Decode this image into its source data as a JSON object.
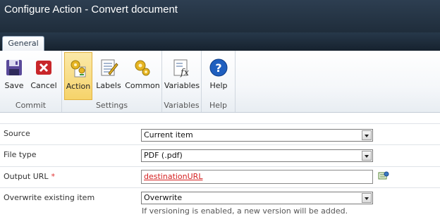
{
  "window": {
    "title": "Configure Action - Convert document"
  },
  "tabs": [
    {
      "label": "General"
    }
  ],
  "ribbon": {
    "groups": [
      {
        "label": "Commit",
        "buttons": [
          {
            "label": "Save",
            "icon": "save-icon"
          },
          {
            "label": "Cancel",
            "icon": "cancel-icon"
          }
        ]
      },
      {
        "label": "Settings",
        "buttons": [
          {
            "label": "Action",
            "icon": "action-gears-icon",
            "active": true
          },
          {
            "label": "Labels",
            "icon": "labels-icon"
          },
          {
            "label": "Common",
            "icon": "common-gears-icon"
          }
        ]
      },
      {
        "label": "Variables",
        "buttons": [
          {
            "label": "Variables",
            "icon": "variables-fx-icon"
          }
        ]
      },
      {
        "label": "Help",
        "buttons": [
          {
            "label": "Help",
            "icon": "help-icon"
          }
        ]
      }
    ]
  },
  "form": {
    "source": {
      "label": "Source",
      "value": "Current item"
    },
    "file_type": {
      "label": "File type",
      "value": "PDF (.pdf)"
    },
    "output_url": {
      "label": "Output URL",
      "required_mark": "*",
      "value": "destinationURL",
      "lookup_icon": "lookup-icon"
    },
    "overwrite": {
      "label": "Overwrite existing item",
      "value": "Overwrite",
      "hint": "If versioning is enabled, a new version will be added."
    }
  },
  "colors": {
    "titlebar": "#2d3e51",
    "active_button": "#f6d36a",
    "required": "#e03030",
    "token": "#d42020"
  }
}
